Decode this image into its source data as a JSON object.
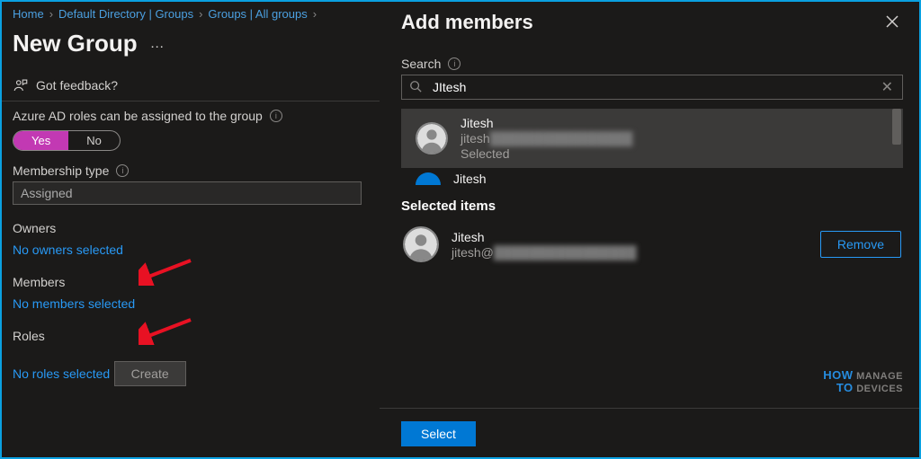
{
  "breadcrumb": {
    "items": [
      "Home",
      "Default Directory | Groups",
      "Groups | All groups"
    ]
  },
  "page": {
    "title": "New Group",
    "more_menu": "…"
  },
  "feedback": {
    "label": "Got feedback?"
  },
  "roles_toggle": {
    "label": "Azure AD roles can be assigned to the group",
    "yes": "Yes",
    "no": "No"
  },
  "membership": {
    "label": "Membership type",
    "value": "Assigned"
  },
  "owners": {
    "heading": "Owners",
    "link": "No owners selected"
  },
  "members": {
    "heading": "Members",
    "link": "No members selected"
  },
  "roles": {
    "heading": "Roles",
    "link": "No roles selected"
  },
  "create_button": "Create",
  "panel": {
    "title": "Add members",
    "search_label": "Search",
    "search_value": "JItesh",
    "results": [
      {
        "name": "Jitesh",
        "email_prefix": "jitesh",
        "email_hidden": "████████████████",
        "status": "Selected"
      },
      {
        "name": "Jitesh"
      }
    ],
    "selected_heading": "Selected items",
    "selected": [
      {
        "name": "Jitesh",
        "email_prefix": "jitesh@",
        "email_hidden": "████████████████"
      }
    ],
    "remove_label": "Remove",
    "select_label": "Select"
  }
}
